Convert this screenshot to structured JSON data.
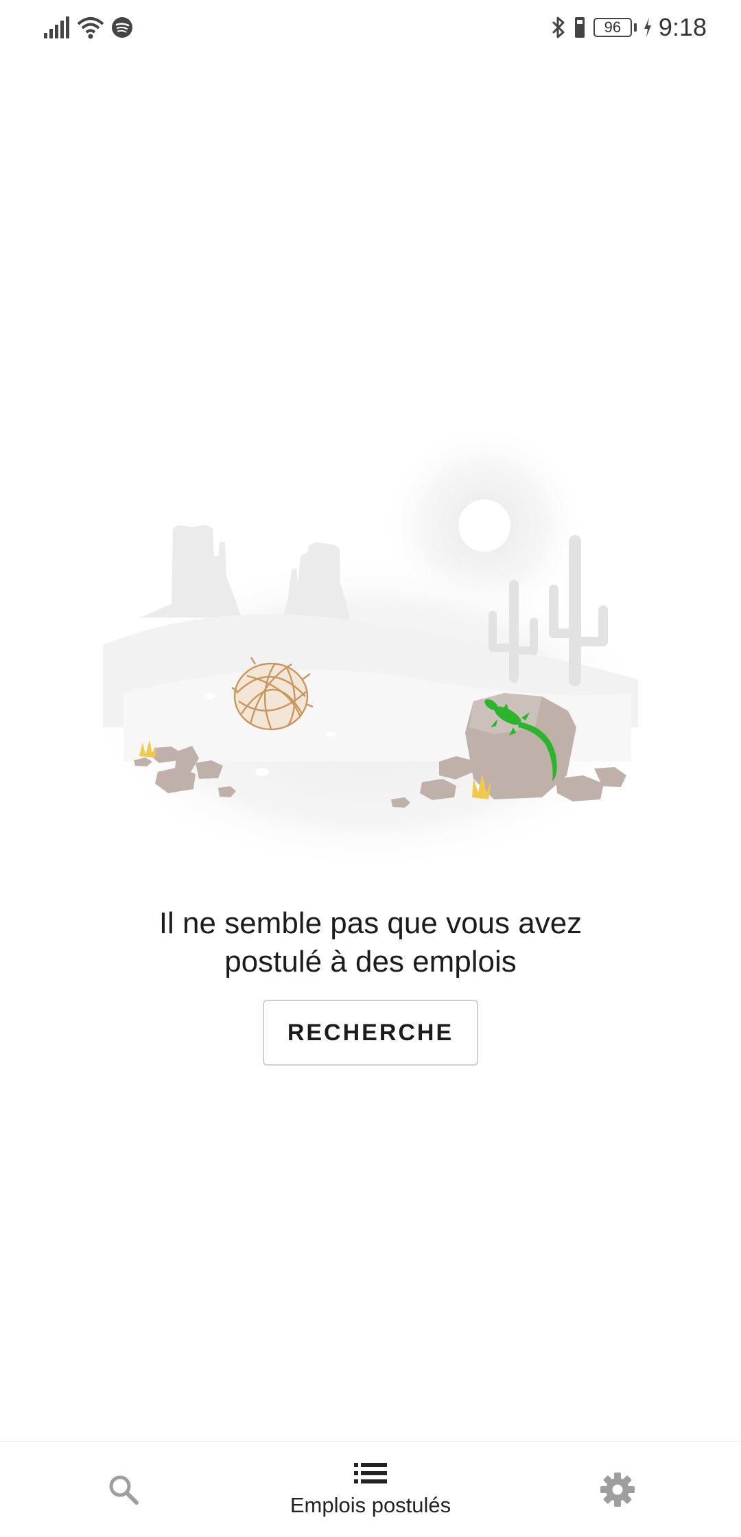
{
  "status_bar": {
    "battery_level": "96",
    "time": "9:18",
    "icons": [
      "signal-icon",
      "wifi-icon",
      "spotify-icon",
      "bluetooth-icon",
      "vibrate-icon",
      "battery-icon",
      "charging-icon"
    ]
  },
  "empty_state": {
    "illustration": "desert-illustration",
    "message_line1": "Il ne semble pas que vous avez",
    "message_line2": "postulé à des emplois",
    "search_button_label": "RECHERCHE"
  },
  "bottom_nav": {
    "items": [
      {
        "icon": "search-icon",
        "label": "",
        "active": false
      },
      {
        "icon": "list-icon",
        "label": "Emplois postulés",
        "active": true
      },
      {
        "icon": "gear-icon",
        "label": "",
        "active": false
      }
    ]
  },
  "colors": {
    "lizard": "#2cb52c",
    "rock": "#bfb1aa",
    "tumbleweed": "#c9965f",
    "grass": "#f2c94c",
    "inactive_icon": "#9e9e9e"
  }
}
